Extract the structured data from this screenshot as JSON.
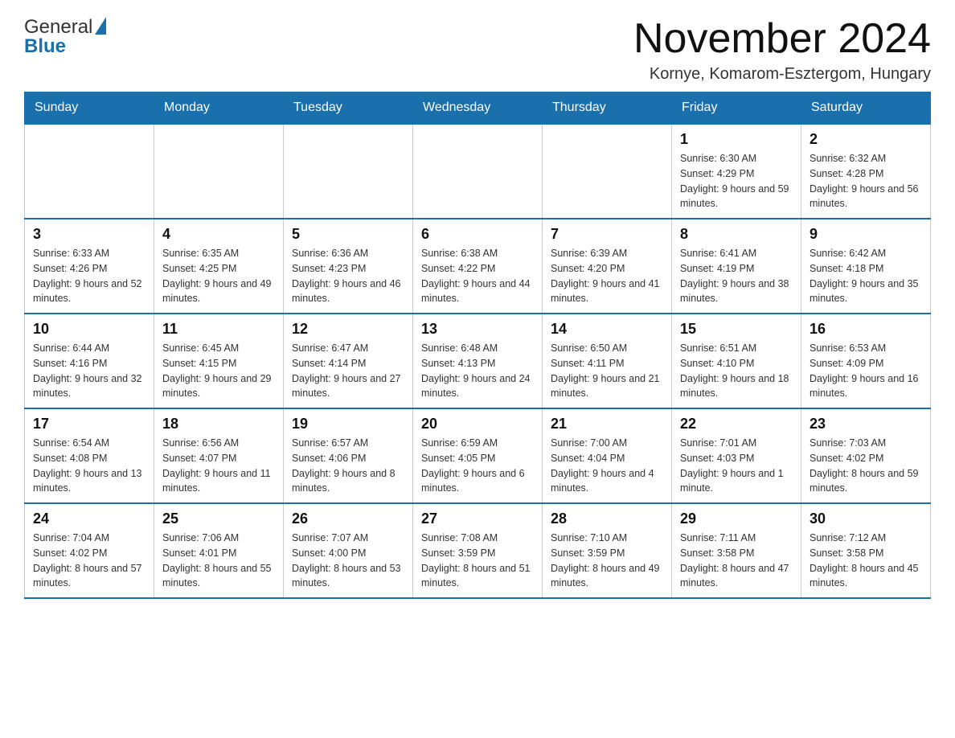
{
  "header": {
    "logo_text1": "General",
    "logo_text2": "Blue",
    "title": "November 2024",
    "subtitle": "Kornye, Komarom-Esztergom, Hungary"
  },
  "weekdays": [
    "Sunday",
    "Monday",
    "Tuesday",
    "Wednesday",
    "Thursday",
    "Friday",
    "Saturday"
  ],
  "weeks": [
    {
      "days": [
        {
          "number": "",
          "info": ""
        },
        {
          "number": "",
          "info": ""
        },
        {
          "number": "",
          "info": ""
        },
        {
          "number": "",
          "info": ""
        },
        {
          "number": "",
          "info": ""
        },
        {
          "number": "1",
          "info": "Sunrise: 6:30 AM\nSunset: 4:29 PM\nDaylight: 9 hours\nand 59 minutes."
        },
        {
          "number": "2",
          "info": "Sunrise: 6:32 AM\nSunset: 4:28 PM\nDaylight: 9 hours\nand 56 minutes."
        }
      ]
    },
    {
      "days": [
        {
          "number": "3",
          "info": "Sunrise: 6:33 AM\nSunset: 4:26 PM\nDaylight: 9 hours\nand 52 minutes."
        },
        {
          "number": "4",
          "info": "Sunrise: 6:35 AM\nSunset: 4:25 PM\nDaylight: 9 hours\nand 49 minutes."
        },
        {
          "number": "5",
          "info": "Sunrise: 6:36 AM\nSunset: 4:23 PM\nDaylight: 9 hours\nand 46 minutes."
        },
        {
          "number": "6",
          "info": "Sunrise: 6:38 AM\nSunset: 4:22 PM\nDaylight: 9 hours\nand 44 minutes."
        },
        {
          "number": "7",
          "info": "Sunrise: 6:39 AM\nSunset: 4:20 PM\nDaylight: 9 hours\nand 41 minutes."
        },
        {
          "number": "8",
          "info": "Sunrise: 6:41 AM\nSunset: 4:19 PM\nDaylight: 9 hours\nand 38 minutes."
        },
        {
          "number": "9",
          "info": "Sunrise: 6:42 AM\nSunset: 4:18 PM\nDaylight: 9 hours\nand 35 minutes."
        }
      ]
    },
    {
      "days": [
        {
          "number": "10",
          "info": "Sunrise: 6:44 AM\nSunset: 4:16 PM\nDaylight: 9 hours\nand 32 minutes."
        },
        {
          "number": "11",
          "info": "Sunrise: 6:45 AM\nSunset: 4:15 PM\nDaylight: 9 hours\nand 29 minutes."
        },
        {
          "number": "12",
          "info": "Sunrise: 6:47 AM\nSunset: 4:14 PM\nDaylight: 9 hours\nand 27 minutes."
        },
        {
          "number": "13",
          "info": "Sunrise: 6:48 AM\nSunset: 4:13 PM\nDaylight: 9 hours\nand 24 minutes."
        },
        {
          "number": "14",
          "info": "Sunrise: 6:50 AM\nSunset: 4:11 PM\nDaylight: 9 hours\nand 21 minutes."
        },
        {
          "number": "15",
          "info": "Sunrise: 6:51 AM\nSunset: 4:10 PM\nDaylight: 9 hours\nand 18 minutes."
        },
        {
          "number": "16",
          "info": "Sunrise: 6:53 AM\nSunset: 4:09 PM\nDaylight: 9 hours\nand 16 minutes."
        }
      ]
    },
    {
      "days": [
        {
          "number": "17",
          "info": "Sunrise: 6:54 AM\nSunset: 4:08 PM\nDaylight: 9 hours\nand 13 minutes."
        },
        {
          "number": "18",
          "info": "Sunrise: 6:56 AM\nSunset: 4:07 PM\nDaylight: 9 hours\nand 11 minutes."
        },
        {
          "number": "19",
          "info": "Sunrise: 6:57 AM\nSunset: 4:06 PM\nDaylight: 9 hours\nand 8 minutes."
        },
        {
          "number": "20",
          "info": "Sunrise: 6:59 AM\nSunset: 4:05 PM\nDaylight: 9 hours\nand 6 minutes."
        },
        {
          "number": "21",
          "info": "Sunrise: 7:00 AM\nSunset: 4:04 PM\nDaylight: 9 hours\nand 4 minutes."
        },
        {
          "number": "22",
          "info": "Sunrise: 7:01 AM\nSunset: 4:03 PM\nDaylight: 9 hours\nand 1 minute."
        },
        {
          "number": "23",
          "info": "Sunrise: 7:03 AM\nSunset: 4:02 PM\nDaylight: 8 hours\nand 59 minutes."
        }
      ]
    },
    {
      "days": [
        {
          "number": "24",
          "info": "Sunrise: 7:04 AM\nSunset: 4:02 PM\nDaylight: 8 hours\nand 57 minutes."
        },
        {
          "number": "25",
          "info": "Sunrise: 7:06 AM\nSunset: 4:01 PM\nDaylight: 8 hours\nand 55 minutes."
        },
        {
          "number": "26",
          "info": "Sunrise: 7:07 AM\nSunset: 4:00 PM\nDaylight: 8 hours\nand 53 minutes."
        },
        {
          "number": "27",
          "info": "Sunrise: 7:08 AM\nSunset: 3:59 PM\nDaylight: 8 hours\nand 51 minutes."
        },
        {
          "number": "28",
          "info": "Sunrise: 7:10 AM\nSunset: 3:59 PM\nDaylight: 8 hours\nand 49 minutes."
        },
        {
          "number": "29",
          "info": "Sunrise: 7:11 AM\nSunset: 3:58 PM\nDaylight: 8 hours\nand 47 minutes."
        },
        {
          "number": "30",
          "info": "Sunrise: 7:12 AM\nSunset: 3:58 PM\nDaylight: 8 hours\nand 45 minutes."
        }
      ]
    }
  ]
}
